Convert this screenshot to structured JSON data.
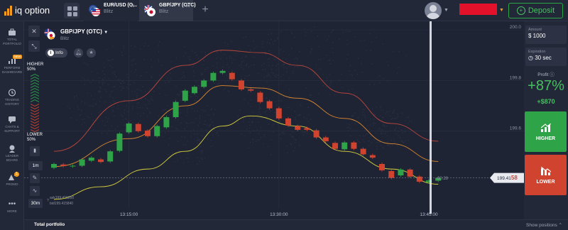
{
  "app": {
    "name": "iq option"
  },
  "tabs": [
    {
      "name": "EUR/USD (O...",
      "type": "Blitz",
      "flag": "eu-us-flag"
    },
    {
      "name": "GBP/JPY (OTC)",
      "type": "Blitz",
      "flag": "uk-jp-flag"
    }
  ],
  "header": {
    "add_tab": "+",
    "deposit_label": "Deposit"
  },
  "sidebar": {
    "items": [
      {
        "label": "TOTAL PORTFOLIO",
        "icon": "briefcase-icon"
      },
      {
        "label": "PERFORM DASHBOARD",
        "icon": "chart-icon",
        "badge": "NEW"
      },
      {
        "label": "TRADING HISTORY",
        "icon": "history-icon"
      },
      {
        "label": "CHATS & SUPPORT",
        "icon": "chat-icon"
      },
      {
        "label": "LEADER BOARD",
        "icon": "trophy-icon"
      },
      {
        "label": "PROMO",
        "icon": "gift-icon",
        "badge": "1"
      },
      {
        "label": "MORE",
        "icon": "more-icon"
      }
    ]
  },
  "asset": {
    "name": "GBP/JPY (OTC)",
    "type": "Blitz",
    "info_label": "Info"
  },
  "indicators": {
    "higher_label": "HIGHER",
    "higher_pct": "50%",
    "lower_label": "LOWER",
    "lower_pct": "50%"
  },
  "timeframes": {
    "candle": "1m",
    "period": "30m"
  },
  "ohlc": {
    "line1": "ask199.415850",
    "line2": "bid199.415840"
  },
  "price": {
    "current_main": "199.41",
    "current_hl": "58",
    "timer": "00:28"
  },
  "right_panel": {
    "amount_label": "Amount",
    "amount_value": "$ 1000",
    "expiration_label": "Expiration",
    "expiration_value": "30 sec",
    "profit_label": "Profit",
    "profit_pct": "+87%",
    "profit_amount": "+$870",
    "higher_button": "HIGHER",
    "lower_button": "LOWER"
  },
  "bottom": {
    "total_portfolio": "Total portfolio",
    "show_positions": "Show positions"
  },
  "colors": {
    "up": "#2fa347",
    "down": "#d0432f",
    "bg": "#1f2435",
    "accent": "#f39b1f"
  },
  "chart_data": {
    "type": "candlestick",
    "x_ticks": [
      "13:15:00",
      "13:30:00",
      "13:45:00"
    ],
    "y_ticks": [
      200.0,
      199.8,
      199.6
    ],
    "ylim": [
      199.31,
      200.02
    ],
    "candles": [
      {
        "o": 199.455,
        "c": 199.47
      },
      {
        "o": 199.468,
        "c": 199.462
      },
      {
        "o": 199.462,
        "c": 199.463
      },
      {
        "o": 199.463,
        "c": 199.488
      },
      {
        "o": 199.483,
        "c": 199.495
      },
      {
        "o": 199.488,
        "c": 199.478
      },
      {
        "o": 199.48,
        "c": 199.52
      },
      {
        "o": 199.522,
        "c": 199.59
      },
      {
        "o": 199.595,
        "c": 199.63
      },
      {
        "o": 199.628,
        "c": 199.6
      },
      {
        "o": 199.602,
        "c": 199.58
      },
      {
        "o": 199.58,
        "c": 199.62
      },
      {
        "o": 199.615,
        "c": 199.655
      },
      {
        "o": 199.655,
        "c": 199.715
      },
      {
        "o": 199.72,
        "c": 199.76
      },
      {
        "o": 199.75,
        "c": 199.775
      },
      {
        "o": 199.775,
        "c": 199.8
      },
      {
        "o": 199.8,
        "c": 199.83
      },
      {
        "o": 199.83,
        "c": 199.838
      },
      {
        "o": 199.83,
        "c": 199.805
      },
      {
        "o": 199.8,
        "c": 199.765
      },
      {
        "o": 199.765,
        "c": 199.76
      },
      {
        "o": 199.752,
        "c": 199.715
      },
      {
        "o": 199.718,
        "c": 199.69
      },
      {
        "o": 199.69,
        "c": 199.65
      },
      {
        "o": 199.65,
        "c": 199.622
      },
      {
        "o": 199.62,
        "c": 199.605
      },
      {
        "o": 199.612,
        "c": 199.605
      },
      {
        "o": 199.603,
        "c": 199.575
      },
      {
        "o": 199.575,
        "c": 199.56
      },
      {
        "o": 199.553,
        "c": 199.53
      },
      {
        "o": 199.528,
        "c": 199.555
      },
      {
        "o": 199.555,
        "c": 199.53
      },
      {
        "o": 199.53,
        "c": 199.508
      },
      {
        "o": 199.505,
        "c": 199.495
      },
      {
        "o": 199.47,
        "c": 199.445
      },
      {
        "o": 199.442,
        "c": 199.415
      },
      {
        "o": 199.425,
        "c": 199.448
      },
      {
        "o": 199.448,
        "c": 199.42
      },
      {
        "o": 199.42,
        "c": 199.4
      },
      {
        "o": 199.398,
        "c": 199.405
      },
      {
        "o": 199.404,
        "c": 199.415
      }
    ],
    "bands": {
      "upper": [
        [
          0,
          199.52
        ],
        [
          8,
          199.72
        ],
        [
          14,
          199.86
        ],
        [
          18,
          199.92
        ],
        [
          22,
          199.91
        ],
        [
          26,
          199.86
        ],
        [
          31,
          199.75
        ],
        [
          36,
          199.63
        ],
        [
          41,
          199.56
        ]
      ],
      "middle": [
        [
          0,
          199.46
        ],
        [
          8,
          199.57
        ],
        [
          14,
          199.7
        ],
        [
          18,
          199.78
        ],
        [
          22,
          199.77
        ],
        [
          26,
          199.73
        ],
        [
          31,
          199.65
        ],
        [
          36,
          199.55
        ],
        [
          41,
          199.48
        ]
      ],
      "lower": [
        [
          0,
          199.33
        ],
        [
          5,
          199.38
        ],
        [
          10,
          199.45
        ],
        [
          14,
          199.52
        ],
        [
          18,
          199.62
        ],
        [
          21,
          199.66
        ],
        [
          26,
          199.62
        ],
        [
          31,
          199.52
        ],
        [
          36,
          199.45
        ],
        [
          41,
          199.39
        ]
      ]
    }
  }
}
